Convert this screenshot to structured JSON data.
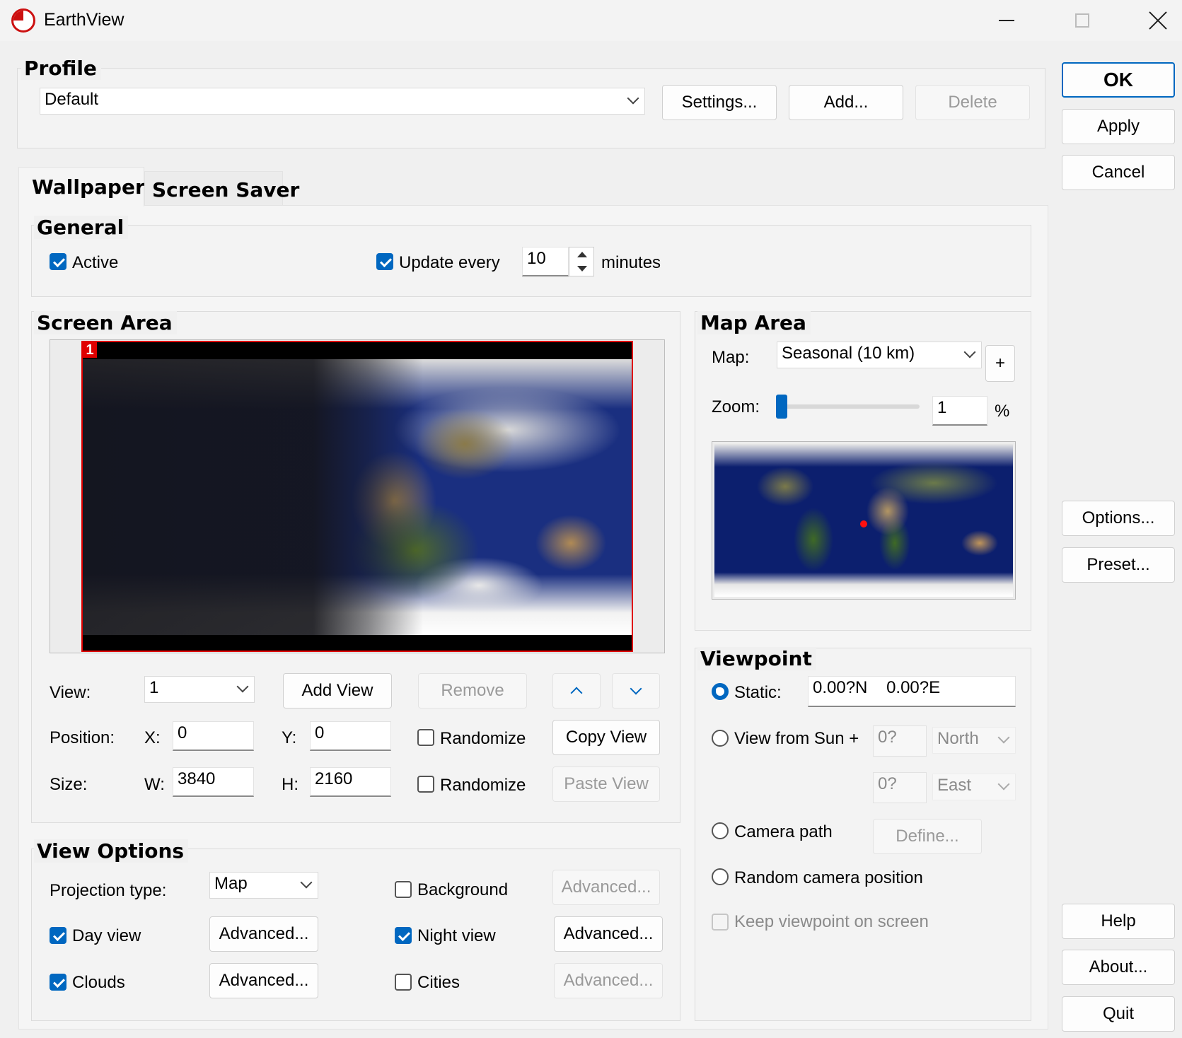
{
  "window": {
    "title": "EarthView",
    "app_icon": "earthview-logo-icon",
    "controls": [
      "minimize-icon",
      "maximize-icon",
      "close-icon"
    ]
  },
  "profile": {
    "title": "Profile",
    "selected": "Default",
    "settings_label": "Settings...",
    "add_label": "Add...",
    "delete_label": "Delete"
  },
  "side_buttons": {
    "ok": "OK",
    "apply": "Apply",
    "cancel": "Cancel",
    "options": "Options...",
    "preset": "Preset...",
    "help": "Help",
    "about": "About...",
    "quit": "Quit"
  },
  "tabs": [
    {
      "label": "Wallpaper",
      "active": true
    },
    {
      "label": "Screen Saver",
      "active": false
    }
  ],
  "general": {
    "title": "General",
    "active_label": "Active",
    "active_checked": true,
    "update_label": "Update every",
    "update_checked": true,
    "update_value": "10",
    "update_unit": "minutes"
  },
  "screen_area": {
    "title": "Screen Area",
    "screen_badge": "1",
    "view_label": "View:",
    "view_value": "1",
    "add_view": "Add View",
    "remove": "Remove",
    "position_label": "Position:",
    "x_label": "X:",
    "x_value": "0",
    "y_label": "Y:",
    "y_value": "0",
    "randomize_position": "Randomize",
    "copy_view": "Copy View",
    "size_label": "Size:",
    "w_label": "W:",
    "w_value": "3840",
    "h_label": "H:",
    "h_value": "2160",
    "randomize_size": "Randomize",
    "paste_view": "Paste View"
  },
  "map_area": {
    "title": "Map Area",
    "map_label": "Map:",
    "map_value": "Seasonal (10 km)",
    "plus": "+",
    "zoom_label": "Zoom:",
    "zoom_value": "1",
    "zoom_unit": "%",
    "zoom_level": 0.0
  },
  "view_options": {
    "title": "View Options",
    "projection_label": "Projection type:",
    "projection_value": "Map",
    "background_label": "Background",
    "background_checked": false,
    "background_advanced": "Advanced...",
    "day_label": "Day view",
    "day_checked": true,
    "day_advanced": "Advanced...",
    "night_label": "Night view",
    "night_checked": true,
    "night_advanced": "Advanced...",
    "clouds_label": "Clouds",
    "clouds_checked": true,
    "clouds_advanced": "Advanced...",
    "cities_label": "Cities",
    "cities_checked": false,
    "cities_advanced": "Advanced..."
  },
  "viewpoint": {
    "title": "Viewpoint",
    "static_label": "Static:",
    "static_value": "0.00?N    0.00?E",
    "sun_label": "View from Sun +",
    "sun_lat": "0?",
    "sun_lat_dir": "North",
    "sun_lon": "0?",
    "sun_lon_dir": "East",
    "camera_label": "Camera path",
    "define_label": "Define...",
    "random_label": "Random camera position",
    "keep_label": "Keep viewpoint on screen"
  },
  "colors": {
    "accent": "#0067c0",
    "window_bg": "#f0f0f0",
    "screen_border": "#e00000",
    "ocean": "#0c1f6e"
  }
}
